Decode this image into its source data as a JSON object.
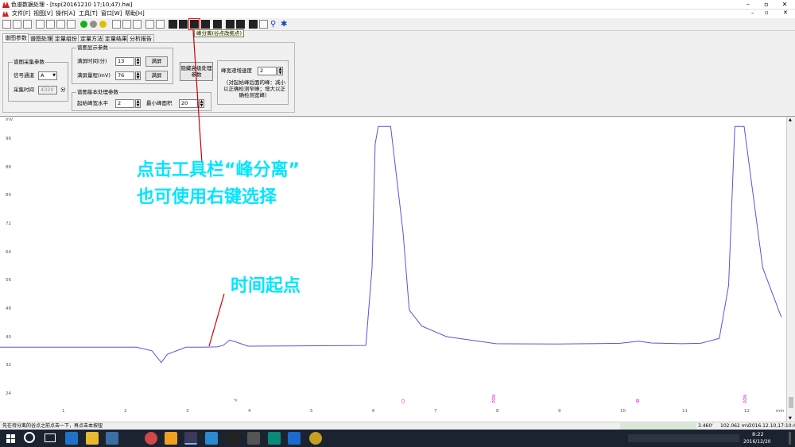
{
  "window": {
    "title": "色谱数据处理 - [tsp(20161210 17;10;47).hw]"
  },
  "menubar": [
    "文件[F]",
    "视图[V]",
    "操作[A]",
    "工具[T]",
    "窗口[W]",
    "帮助[H]"
  ],
  "tooltip": "峰分离(谷点改拖点)",
  "tabs": [
    "谱图参数",
    "谱图处理",
    "定量组份",
    "定量方法",
    "定量结果",
    "分析报告"
  ],
  "panel": {
    "acq_group": "谱图采集参数",
    "channel_label": "信号通道",
    "channel_value": "A",
    "acq_time_label": "采集时间",
    "acq_time_value": "4320",
    "acq_time_unit": "分",
    "display_group": "谱图显示参数",
    "full_time_label": "满屏时间(分)",
    "full_time_value": "13",
    "full_range_label": "满屏量程(mV)",
    "full_range_value": "76",
    "full_btn": "满屏",
    "hide_btn": "隐藏高级处理参数",
    "basic_group": "谱图基本处理参数",
    "baseline_label": "起始峰宽水平",
    "baseline_value": "2",
    "min_area_label": "最小峰面积",
    "min_area_value": "20",
    "peakwidth_label": "峰宽递增速度",
    "peakwidth_value": "2",
    "hint": "（对起始峰后面的峰：减小以正确检测窄峰；增大以正确检测宽峰）"
  },
  "chart": {
    "y_unit": "mV",
    "x_unit": "min",
    "y_ticks": [
      "96",
      "88",
      "80",
      "72",
      "64",
      "56",
      "48",
      "40",
      "32",
      "24"
    ],
    "x_ticks": [
      "1",
      "2",
      "3",
      "4",
      "5",
      "6",
      "7",
      "8",
      "9",
      "10",
      "11",
      "12"
    ],
    "peak_marks": [
      "F",
      "Cl",
      "NO2",
      "Br",
      "NO3"
    ]
  },
  "chart_data": {
    "type": "line",
    "xlabel": "min",
    "ylabel": "mV",
    "xlim": [
      0,
      12.7
    ],
    "ylim": [
      20,
      100
    ],
    "series": [
      {
        "x": [
          0,
          2.2,
          2.45,
          2.6,
          2.7,
          3.0,
          3.2,
          3.5,
          3.6,
          3.7,
          3.8,
          4.0,
          5.9,
          6.0,
          6.05,
          6.1,
          6.3,
          6.5,
          6.6,
          6.8,
          7.2,
          8.0,
          9.0,
          10.0,
          10.3,
          10.5,
          11.0,
          11.3,
          11.6,
          11.75,
          11.85,
          12.0,
          12.3,
          12.6
        ],
        "y": [
          37.5,
          37.5,
          36.5,
          33.2,
          35.5,
          37.5,
          37.5,
          37.6,
          38.0,
          39.5,
          39.0,
          37.8,
          38.0,
          60.0,
          95.0,
          100.0,
          100.0,
          70.0,
          48.0,
          43.5,
          40.5,
          38.5,
          38.4,
          38.6,
          39.2,
          38.7,
          38.5,
          38.6,
          40.0,
          55.0,
          100.0,
          100.0,
          60.0,
          46.0
        ]
      }
    ]
  },
  "annotations": {
    "toolbar_tip_1": "点击工具栏“峰分离”",
    "toolbar_tip_2": "也可使用右键选择",
    "time_start": "时间起点"
  },
  "status": {
    "hint": "先在待分离的谷点之前点击一下，再点击本按钮",
    "time": "3.460'",
    "value": "102.062 mV",
    "file": "2016.12.10,17:10:4"
  },
  "taskbar": {
    "clock_time": "8:22",
    "clock_date": "2016/12/20"
  },
  "colors": {
    "curve": "#5555dd",
    "annotation": "#00e5ff",
    "arrow": "#cc0000",
    "peak_mark": "#d000d0"
  }
}
